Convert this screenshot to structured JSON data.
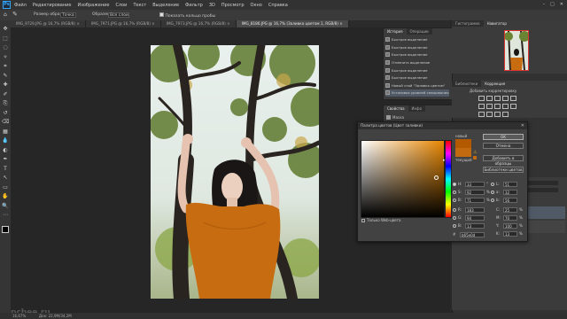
{
  "app": {
    "logo": "Ps"
  },
  "menu": [
    "Файл",
    "Редактирование",
    "Изображение",
    "Слои",
    "Текст",
    "Выделение",
    "Фильтр",
    "3D",
    "Просмотр",
    "Окно",
    "Справка"
  ],
  "options": {
    "feather_label": "Размер образца:",
    "feather_value": "Точка",
    "sample_label": "Образец:",
    "sample_value": "Все слои",
    "show_ring": "Показать кольцо пробы"
  },
  "tabs": [
    {
      "label": "IMG_9729.JPG @ 16,7% (RGB/8)",
      "active": false
    },
    {
      "label": "IMG_7971.JPG @ 16,7% (RGB/8)",
      "active": false
    },
    {
      "label": "IMG_7973.JPG @ 16,7% (RGB/8)",
      "active": false
    },
    {
      "label": "IMG_8186.JPG @ 16,7% (Заливка цветом 1, RGB/8)",
      "active": true
    }
  ],
  "history": {
    "tabs": [
      "История",
      "Операции"
    ],
    "items": [
      "Быстрое выделение",
      "Быстрое выделение",
      "Быстрое выделение",
      "Отменить выделение",
      "Быстрое выделение",
      "Быстрое выделение",
      "Новый слой \"Заливка цветом\"",
      "Установка уровней смешивания"
    ]
  },
  "properties": {
    "tabs": [
      "Свойства",
      "Инфо"
    ],
    "subtitle": "Маска"
  },
  "navigator": {
    "tabs": [
      "Гистограмма",
      "Навигатор"
    ]
  },
  "adjustments": {
    "tabs": [
      "Библиотеки",
      "Коррекция"
    ],
    "subtitle": "Добавить корректировку"
  },
  "picker": {
    "title": "Палитра цветов (Цвет заливки)",
    "new_label": "новый",
    "current_label": "текущий",
    "ok": "OK",
    "cancel": "Отмена",
    "add_swatch": "Добавить в образцы",
    "libraries": "Библиотеки цветов",
    "web_only": "Только Web-цвета",
    "H": "33",
    "S": "92",
    "B": "71",
    "R": "183",
    "G": "94",
    "Bv": "13",
    "L": "51",
    "a": "32",
    "b": "56",
    "C": "25",
    "M": "70",
    "Y": "100",
    "K": "13",
    "hex": "b65e0d",
    "deg": "°",
    "pct": "%"
  },
  "status": {
    "zoom": "16,67%",
    "doc": "Док: 22,9М/34,2М"
  },
  "watermark": "pcbee.ru"
}
